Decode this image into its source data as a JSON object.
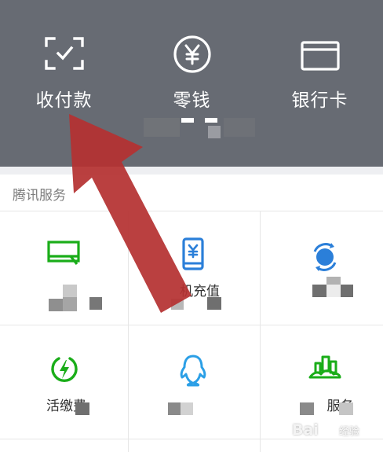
{
  "header": {
    "buttons": [
      {
        "label": "收付款",
        "icon": "scan-frame-check-icon"
      },
      {
        "label": "零钱",
        "icon": "yen-circle-icon"
      },
      {
        "label": "银行卡",
        "icon": "bank-card-icon"
      }
    ],
    "background": "#676b73"
  },
  "section": {
    "title": "腾讯服务"
  },
  "services": [
    {
      "label": "",
      "icon": "wallet-envelope-icon",
      "color": "#1aad19"
    },
    {
      "label": "机充值",
      "icon": "phone-yen-icon",
      "color": "#2b7fd9"
    },
    {
      "label": "",
      "icon": "refresh-coin-icon",
      "color": "#2b7fd9"
    },
    {
      "label": "活缴费",
      "icon": "lightning-circle-icon",
      "color": "#1aad19"
    },
    {
      "label": "",
      "icon": "qq-penguin-icon",
      "color": "#2b9fe6"
    },
    {
      "label": "服务",
      "icon": "city-building-icon",
      "color": "#1aad19"
    }
  ],
  "watermark": {
    "brand": "Bai",
    "suffix": "经验"
  },
  "colors": {
    "arrow": "#b53232",
    "divider": "#e6e6e6"
  }
}
